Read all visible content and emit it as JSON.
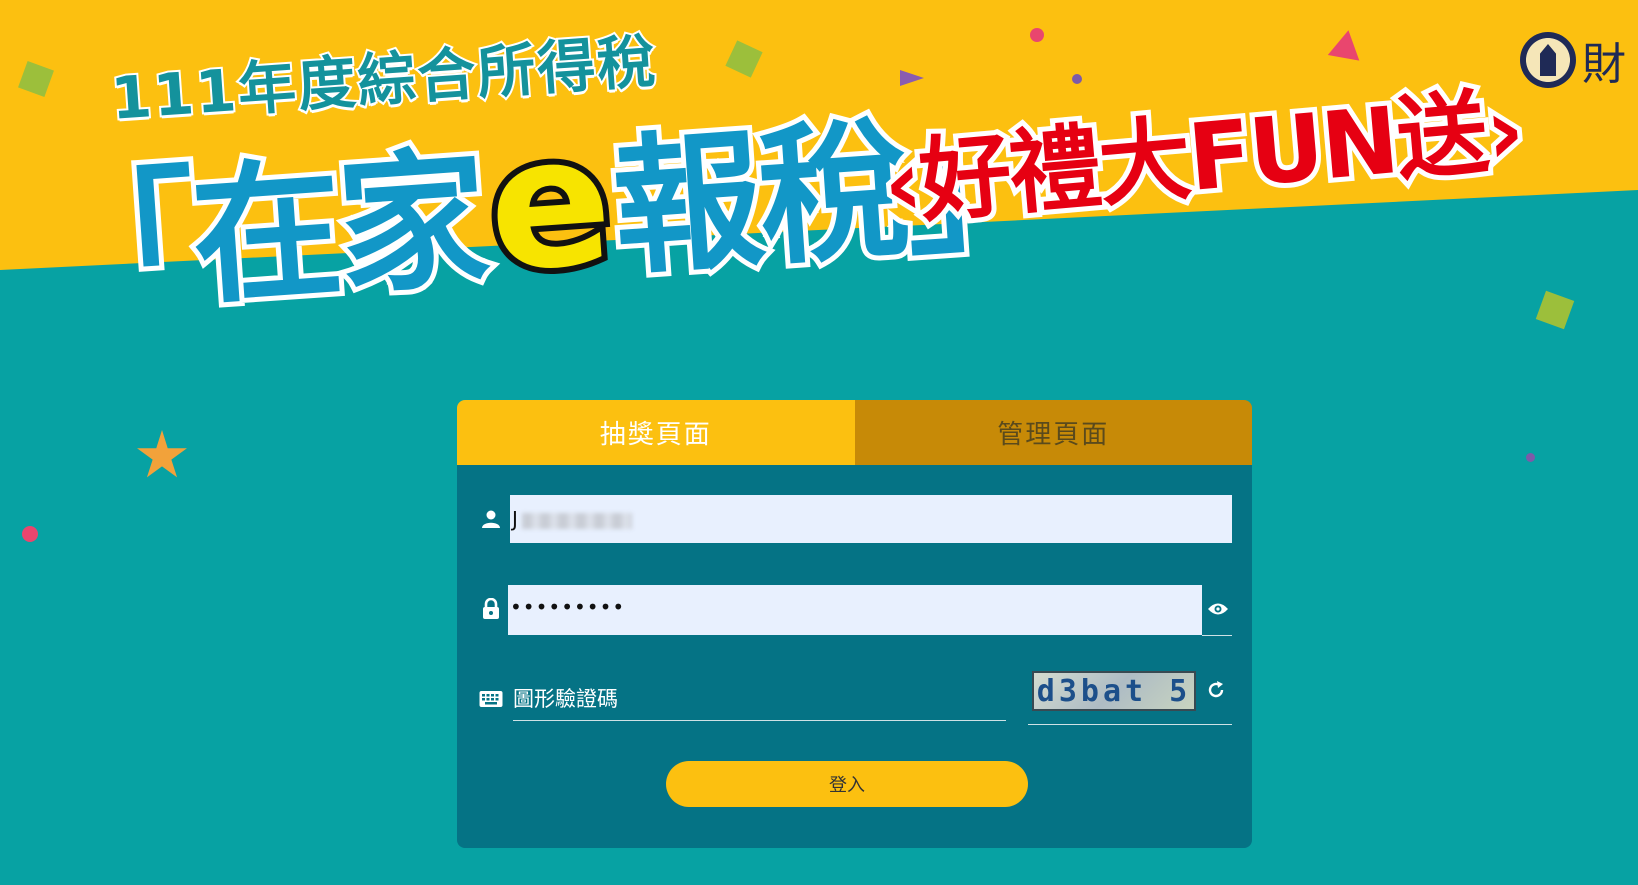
{
  "banner": {
    "year_line": "111年度綜合所得稅",
    "main_prefix": "「在家",
    "main_e": "e",
    "main_suffix": "報稅」",
    "gift_line": "‹好禮大FUN送›",
    "logo_text": "財"
  },
  "tabs": [
    {
      "label": "抽獎頁面",
      "active": true
    },
    {
      "label": "管理頁面",
      "active": false
    }
  ],
  "form": {
    "username_value": "J",
    "password_value": "•••••••••",
    "captcha_placeholder": "圖形驗證碼",
    "captcha_text": "d3bat 5",
    "login_label": "登入"
  },
  "icons": {
    "user": "user-icon",
    "lock": "lock-icon",
    "eye": "eye-icon",
    "keyboard": "keyboard-icon",
    "refresh": "refresh-icon"
  },
  "colors": {
    "yellow": "#fcc010",
    "teal": "#07a2a3",
    "panel": "#057385",
    "title_blue": "#1297c7",
    "gift_red": "#e60012"
  }
}
